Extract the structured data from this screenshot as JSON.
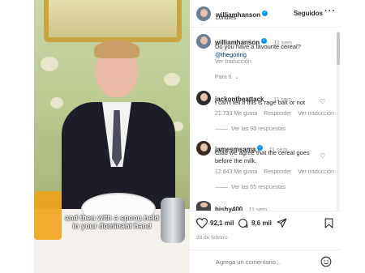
{
  "video": {
    "caption_line1": "and then with a spoon held",
    "caption_line2": "in your dominant hand"
  },
  "post_header": {
    "username": "williamhanson",
    "location": "Londres",
    "follow_label": "Seguidos",
    "more_icon": "more-horizontal-icon"
  },
  "caption": {
    "username": "williamhanson",
    "time": "11 sem",
    "text": "Do you have a favourite cereal?",
    "mention": "@thegoring",
    "translate_label": "Ver traducción"
  },
  "sort": {
    "label": "Para ti"
  },
  "comments": [
    {
      "username": "jackontheattack_",
      "time": "11 sem",
      "text": "I can't tell if this is rage bait or not",
      "likes": "21.733 Me gusta",
      "reply_label": "Responder",
      "translate_label": "Ver traducción",
      "replies_label": "Ver las 90 respuestas"
    },
    {
      "username": "jamesmsama",
      "time": "11 sem",
      "text_line1": "Glad we agree that the cereal goes",
      "text_line2": "before the milk.",
      "likes": "12.843 Me gusta",
      "reply_label": "Responder",
      "translate_label": "Ver traducción",
      "replies_label": "Ver las 55 respuestas"
    },
    {
      "username": "bishy400",
      "time": "11 sem"
    }
  ],
  "actions": {
    "like_count": "92,1 mil",
    "comment_count": "9,6 mil",
    "date": "28 de febrero"
  },
  "composer": {
    "placeholder": "Agrega un comentario..."
  },
  "colors": {
    "verified": "#0095f6",
    "link": "#00376b",
    "muted": "#8e8e8e"
  }
}
